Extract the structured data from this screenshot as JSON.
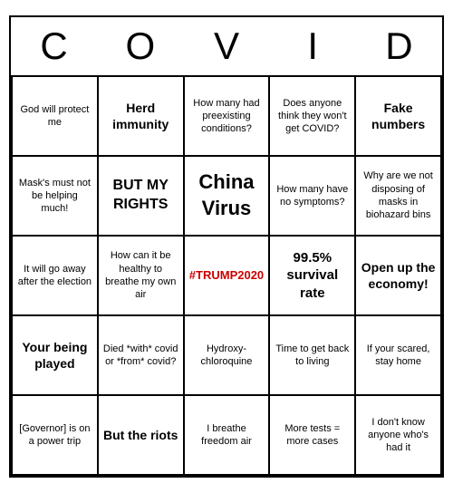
{
  "header": {
    "letters": [
      "C",
      "O",
      "V",
      "I",
      "D"
    ]
  },
  "cells": [
    {
      "text": "God will protect me",
      "style": "normal"
    },
    {
      "text": "Herd immunity",
      "style": "medium"
    },
    {
      "text": "How many had preexisting conditions?",
      "style": "normal"
    },
    {
      "text": "Does anyone think they won't get COVID?",
      "style": "normal"
    },
    {
      "text": "Fake numbers",
      "style": "medium"
    },
    {
      "text": "Mask's must not be helping much!",
      "style": "normal"
    },
    {
      "text": "BUT MY RIGHTS",
      "style": "rights"
    },
    {
      "text": "China Virus",
      "style": "large"
    },
    {
      "text": "How many have no symptoms?",
      "style": "normal"
    },
    {
      "text": "Why are we not disposing of masks in biohazard bins",
      "style": "normal"
    },
    {
      "text": "It will go away after the election",
      "style": "normal"
    },
    {
      "text": "How can it be healthy to breathe my own air",
      "style": "normal"
    },
    {
      "text": "#TRUMP2020",
      "style": "red"
    },
    {
      "text": "99.5% survival rate",
      "style": "survival"
    },
    {
      "text": "Open up the economy!",
      "style": "medium"
    },
    {
      "text": "Your being played",
      "style": "medium"
    },
    {
      "text": "Died *with* covid or *from* covid?",
      "style": "normal"
    },
    {
      "text": "Hydroxy-chloroquine",
      "style": "normal"
    },
    {
      "text": "Time to get back to living",
      "style": "normal"
    },
    {
      "text": "If your scared, stay home",
      "style": "normal"
    },
    {
      "text": "[Governor] is on a power trip",
      "style": "normal"
    },
    {
      "text": "But the riots",
      "style": "medium"
    },
    {
      "text": "I breathe freedom air",
      "style": "normal"
    },
    {
      "text": "More tests = more cases",
      "style": "normal"
    },
    {
      "text": "I don't know anyone who's had it",
      "style": "normal"
    }
  ]
}
